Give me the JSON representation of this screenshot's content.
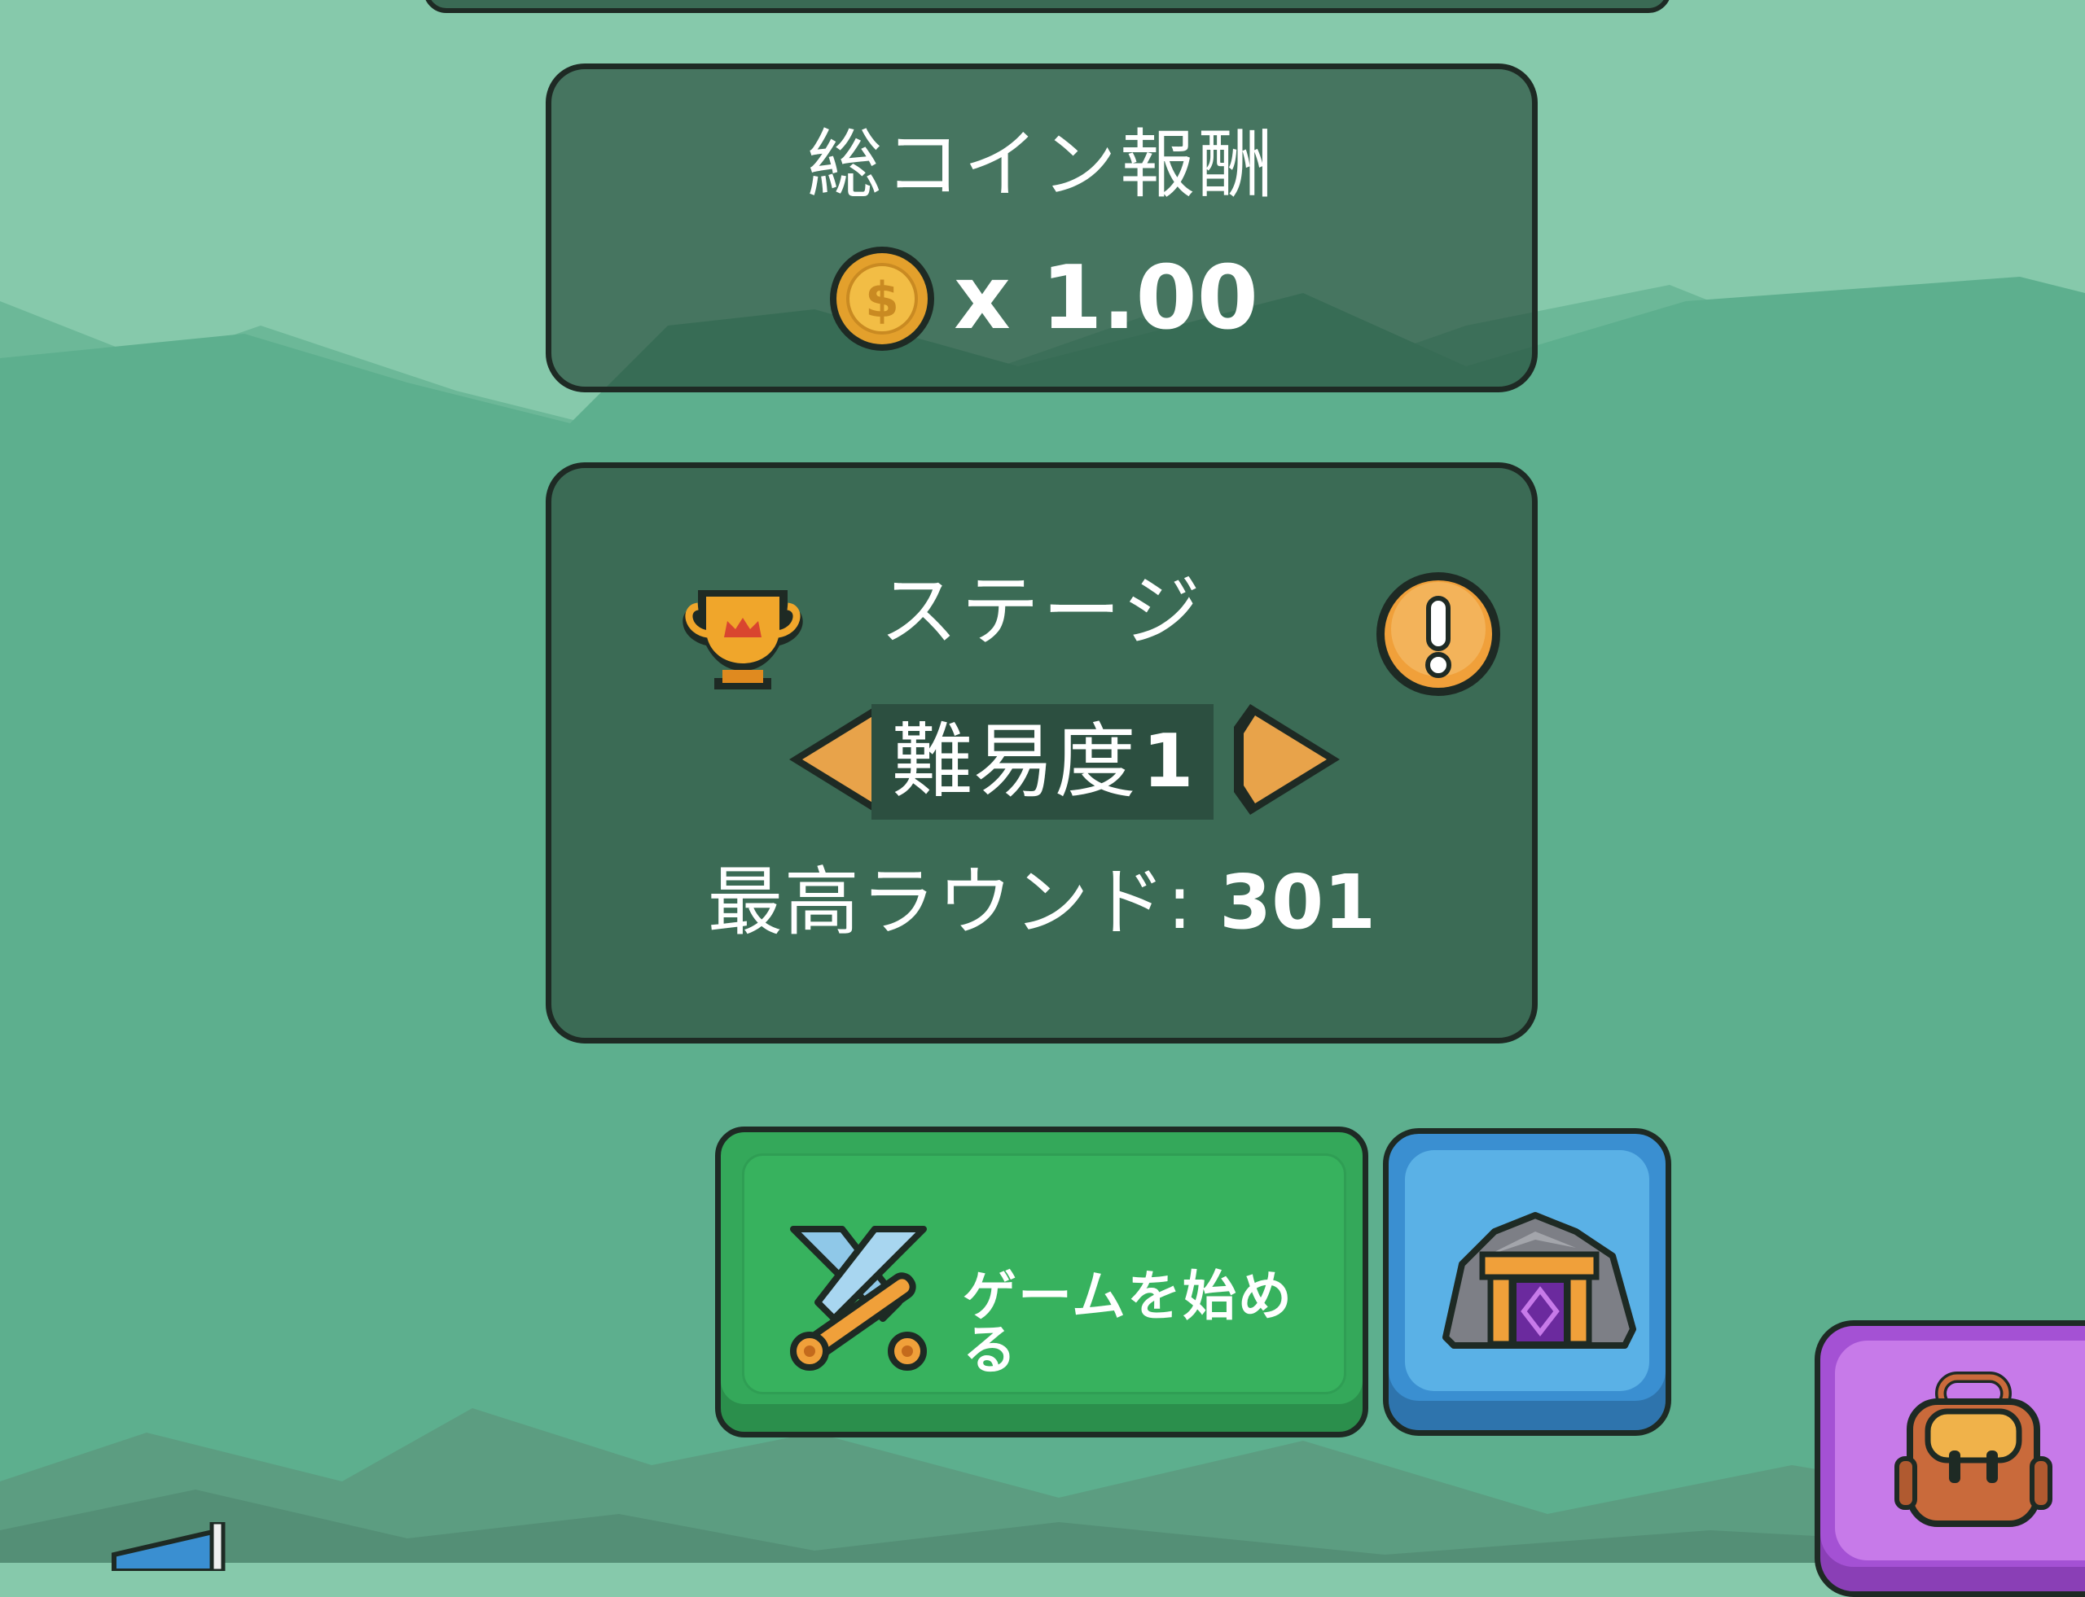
{
  "reward": {
    "title": "総コイン報酬",
    "multiplier": "x 1.00",
    "coin_icon": "coin-icon"
  },
  "stage": {
    "title": "ステージ",
    "difficulty_label": "難易度",
    "difficulty_value": "1",
    "best_round_label": "最高ラウンド:",
    "best_round_value": "301",
    "trophy_icon": "trophy-icon",
    "info_icon": "exclamation-icon"
  },
  "actions": {
    "start_label": "ゲームを始める",
    "start_icon": "crossed-swords-icon",
    "portal_icon": "stone-portal-icon",
    "bag_icon": "backpack-icon"
  },
  "colors": {
    "sky": "#86c9ab",
    "mountain": "#5daf8e",
    "panel_dark": "#3b6b55",
    "start_green": "#37b25e",
    "portal_blue": "#5ab1e6",
    "bag_purple": "#c77ae9",
    "arrow_orange": "#e8a34a"
  }
}
